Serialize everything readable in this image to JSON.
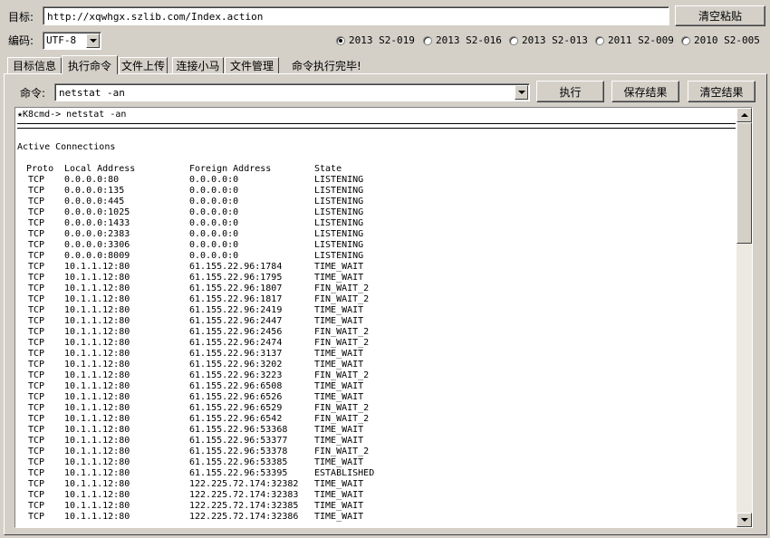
{
  "target": {
    "label": "目标:",
    "url": "http://xqwhgx.szlib.com/Index.action",
    "clear_paste_label": "清空粘贴"
  },
  "encoding": {
    "label": "编码:",
    "value": "UTF-8"
  },
  "versions": [
    {
      "label": "2013 S2-019",
      "selected": true
    },
    {
      "label": "2013 S2-016",
      "selected": false
    },
    {
      "label": "2013 S2-013",
      "selected": false
    },
    {
      "label": "2011 S2-009",
      "selected": false
    },
    {
      "label": "2010 S2-005",
      "selected": false
    }
  ],
  "tabs": [
    {
      "label": "目标信息",
      "active": false
    },
    {
      "label": "执行命令",
      "active": true
    },
    {
      "label": "文件上传",
      "active": false
    },
    {
      "label": "连接小马",
      "active": false
    },
    {
      "label": "文件管理",
      "active": false
    }
  ],
  "status_message": "命令执行完毕!",
  "command": {
    "label": "命令:",
    "value": "netstat -an",
    "execute_label": "执行",
    "save_label": "保存结果",
    "clear_label": "清空结果"
  },
  "output": {
    "prompt": "★K8cmd-> netstat -an",
    "heading": "Active Connections",
    "columns": [
      "Proto",
      "Local Address",
      "Foreign Address",
      "State"
    ],
    "rows": [
      [
        "TCP",
        "0.0.0.0:80",
        "0.0.0.0:0",
        "LISTENING"
      ],
      [
        "TCP",
        "0.0.0.0:135",
        "0.0.0.0:0",
        "LISTENING"
      ],
      [
        "TCP",
        "0.0.0.0:445",
        "0.0.0.0:0",
        "LISTENING"
      ],
      [
        "TCP",
        "0.0.0.0:1025",
        "0.0.0.0:0",
        "LISTENING"
      ],
      [
        "TCP",
        "0.0.0.0:1433",
        "0.0.0.0:0",
        "LISTENING"
      ],
      [
        "TCP",
        "0.0.0.0:2383",
        "0.0.0.0:0",
        "LISTENING"
      ],
      [
        "TCP",
        "0.0.0.0:3306",
        "0.0.0.0:0",
        "LISTENING"
      ],
      [
        "TCP",
        "0.0.0.0:8009",
        "0.0.0.0:0",
        "LISTENING"
      ],
      [
        "TCP",
        "10.1.1.12:80",
        "61.155.22.96:1784",
        "TIME_WAIT"
      ],
      [
        "TCP",
        "10.1.1.12:80",
        "61.155.22.96:1795",
        "TIME_WAIT"
      ],
      [
        "TCP",
        "10.1.1.12:80",
        "61.155.22.96:1807",
        "FIN_WAIT_2"
      ],
      [
        "TCP",
        "10.1.1.12:80",
        "61.155.22.96:1817",
        "FIN_WAIT_2"
      ],
      [
        "TCP",
        "10.1.1.12:80",
        "61.155.22.96:2419",
        "TIME_WAIT"
      ],
      [
        "TCP",
        "10.1.1.12:80",
        "61.155.22.96:2447",
        "TIME_WAIT"
      ],
      [
        "TCP",
        "10.1.1.12:80",
        "61.155.22.96:2456",
        "FIN_WAIT_2"
      ],
      [
        "TCP",
        "10.1.1.12:80",
        "61.155.22.96:2474",
        "FIN_WAIT_2"
      ],
      [
        "TCP",
        "10.1.1.12:80",
        "61.155.22.96:3137",
        "TIME_WAIT"
      ],
      [
        "TCP",
        "10.1.1.12:80",
        "61.155.22.96:3202",
        "TIME_WAIT"
      ],
      [
        "TCP",
        "10.1.1.12:80",
        "61.155.22.96:3223",
        "FIN_WAIT_2"
      ],
      [
        "TCP",
        "10.1.1.12:80",
        "61.155.22.96:6508",
        "TIME_WAIT"
      ],
      [
        "TCP",
        "10.1.1.12:80",
        "61.155.22.96:6526",
        "TIME_WAIT"
      ],
      [
        "TCP",
        "10.1.1.12:80",
        "61.155.22.96:6529",
        "FIN_WAIT_2"
      ],
      [
        "TCP",
        "10.1.1.12:80",
        "61.155.22.96:6542",
        "FIN_WAIT_2"
      ],
      [
        "TCP",
        "10.1.1.12:80",
        "61.155.22.96:53368",
        "TIME_WAIT"
      ],
      [
        "TCP",
        "10.1.1.12:80",
        "61.155.22.96:53377",
        "TIME_WAIT"
      ],
      [
        "TCP",
        "10.1.1.12:80",
        "61.155.22.96:53378",
        "FIN_WAIT_2"
      ],
      [
        "TCP",
        "10.1.1.12:80",
        "61.155.22.96:53385",
        "TIME_WAIT"
      ],
      [
        "TCP",
        "10.1.1.12:80",
        "61.155.22.96:53395",
        "ESTABLISHED"
      ],
      [
        "TCP",
        "10.1.1.12:80",
        "122.225.72.174:32382",
        "TIME_WAIT"
      ],
      [
        "TCP",
        "10.1.1.12:80",
        "122.225.72.174:32383",
        "TIME_WAIT"
      ],
      [
        "TCP",
        "10.1.1.12:80",
        "122.225.72.174:32385",
        "TIME_WAIT"
      ],
      [
        "TCP",
        "10.1.1.12:80",
        "122.225.72.174:32386",
        "TIME_WAIT"
      ]
    ]
  },
  "icons": {
    "dropdown": "chevron-down-icon",
    "scroll_up": "arrow-up-icon",
    "scroll_down": "arrow-down-icon"
  }
}
